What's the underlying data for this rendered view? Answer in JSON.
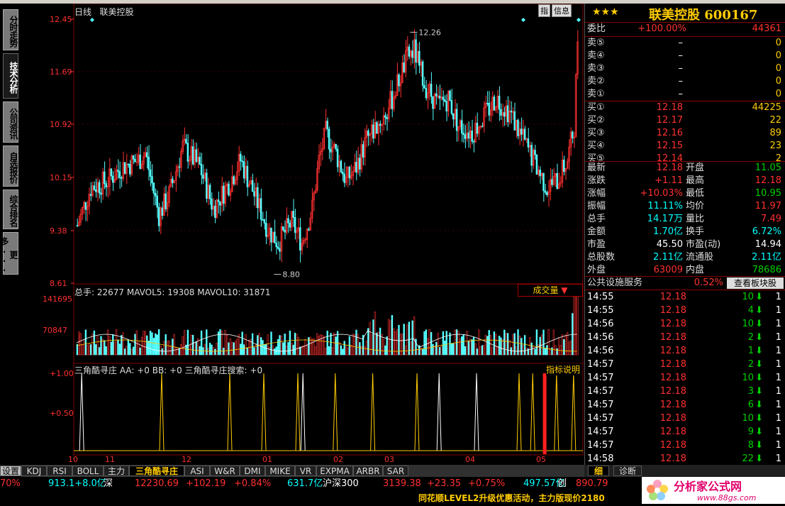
{
  "left_tabs": [
    "分时走势",
    "技术分析",
    "公司资讯",
    "自选报价",
    "综合排名",
    "更多..."
  ],
  "chart": {
    "period_label": "日线",
    "stock_label": "联美控股",
    "info_buttons": [
      "指",
      "信息"
    ],
    "price_axis": [
      "12.45",
      "11.69",
      "10.92",
      "10.15",
      "9.38",
      "8.61"
    ],
    "high_marker": "12.26",
    "low_marker": "8.80",
    "volume_title": "总手: 22677  MAVOL5: 19308  MAVOL10: 31871",
    "volume_axis": [
      "141695",
      "70847"
    ],
    "volume_dropdown": "成交量",
    "indicator_title": "三角酷寻庄 AA: +0  BB: +0  三角酷寻庄搜索: +0",
    "indicator_axis": [
      "+1.00",
      "+0.50"
    ],
    "indicator_explain": "指标说明",
    "month_axis": [
      "10",
      "11",
      "12",
      "01",
      "02",
      "03",
      "04",
      "05"
    ]
  },
  "bottom_tabs": [
    "设置",
    "KDJ",
    "RSI",
    "BOLL",
    "主力",
    "三角酷寻庄",
    "ASI",
    "W&R",
    "DMI",
    "MIKE",
    "VR",
    "EXPMA",
    "ARBR",
    "SAR"
  ],
  "quote": {
    "stars": "★★★",
    "title": "联美控股 600167",
    "weibi": {
      "label": "委比",
      "value": "+100.00%",
      "volume": "44361"
    },
    "sells": [
      {
        "label": "卖⑤",
        "price": "–",
        "vol": "0"
      },
      {
        "label": "卖④",
        "price": "–",
        "vol": "0"
      },
      {
        "label": "卖③",
        "price": "–",
        "vol": "0"
      },
      {
        "label": "卖②",
        "price": "–",
        "vol": "0"
      },
      {
        "label": "卖①",
        "price": "–",
        "vol": "0"
      }
    ],
    "buys": [
      {
        "label": "买①",
        "price": "12.18",
        "vol": "44225"
      },
      {
        "label": "买②",
        "price": "12.17",
        "vol": "22"
      },
      {
        "label": "买③",
        "price": "12.16",
        "vol": "89"
      },
      {
        "label": "买④",
        "price": "12.15",
        "vol": "23"
      },
      {
        "label": "买⑤",
        "price": "12.14",
        "vol": "2"
      }
    ],
    "stats": [
      {
        "l1": "最新",
        "v1": "12.18",
        "c1": "red",
        "l2": "开盘",
        "v2": "11.05",
        "c2": "grn"
      },
      {
        "l1": "涨跌",
        "v1": "+1.11",
        "c1": "red",
        "l2": "最高",
        "v2": "12.18",
        "c2": "red"
      },
      {
        "l1": "涨幅",
        "v1": "+10.03%",
        "c1": "red",
        "l2": "最低",
        "v2": "10.95",
        "c2": "grn"
      },
      {
        "l1": "振幅",
        "v1": "11.11%",
        "c1": "cyan",
        "l2": "均价",
        "v2": "11.97",
        "c2": "red"
      },
      {
        "l1": "总手",
        "v1": "14.17万",
        "c1": "cyan",
        "l2": "量比",
        "v2": "7.49",
        "c2": "red"
      },
      {
        "l1": "金额",
        "v1": "1.70亿",
        "c1": "cyan",
        "l2": "换手",
        "v2": "6.72%",
        "c2": "cyan"
      },
      {
        "l1": "市盈",
        "v1": "45.50",
        "c1": "wht",
        "l2": "市盈(动)",
        "v2": "14.94",
        "c2": "wht"
      },
      {
        "l1": "总股数",
        "v1": "2.11亿",
        "c1": "cyan",
        "l2": "流通股",
        "v2": "2.11亿",
        "c2": "cyan"
      },
      {
        "l1": "外盘",
        "v1": "63009",
        "c1": "red",
        "l2": "内盘",
        "v2": "78686",
        "c2": "grn"
      }
    ],
    "sector": {
      "name": "公共设施服务",
      "pct": "0.52%",
      "button": "查看板块股"
    },
    "ticks": [
      {
        "time": "14:55",
        "price": "12.18",
        "vol": "10",
        "n": "1"
      },
      {
        "time": "14:55",
        "price": "12.18",
        "vol": "4",
        "n": "1"
      },
      {
        "time": "14:56",
        "price": "12.18",
        "vol": "10",
        "n": "1"
      },
      {
        "time": "14:56",
        "price": "12.18",
        "vol": "2",
        "n": "1"
      },
      {
        "time": "14:56",
        "price": "12.18",
        "vol": "1",
        "n": "1"
      },
      {
        "time": "14:57",
        "price": "12.18",
        "vol": "2",
        "n": "1"
      },
      {
        "time": "14:57",
        "price": "12.18",
        "vol": "10",
        "n": "1"
      },
      {
        "time": "14:57",
        "price": "12.18",
        "vol": "3",
        "n": "1"
      },
      {
        "time": "14:57",
        "price": "12.18",
        "vol": "6",
        "n": "1"
      },
      {
        "time": "14:57",
        "price": "12.18",
        "vol": "10",
        "n": "1"
      },
      {
        "time": "14:57",
        "price": "12.18",
        "vol": "9",
        "n": "1"
      },
      {
        "time": "14:57",
        "price": "12.18",
        "vol": "8",
        "n": "1"
      },
      {
        "time": "14:58",
        "price": "12.18",
        "vol": "22",
        "n": "1"
      }
    ],
    "detail_tabs": [
      "细",
      "诊断"
    ]
  },
  "footer": {
    "items": [
      {
        "t": "70%",
        "c": "red"
      },
      {
        "t": "913.1+8.0亿",
        "c": "cyan"
      },
      {
        "t": "深",
        "c": "wht"
      },
      {
        "t": "12230.69",
        "c": "red"
      },
      {
        "t": "+102.19",
        "c": "red"
      },
      {
        "t": "+0.84%",
        "c": "red"
      },
      {
        "t": "631.7亿",
        "c": "cyan"
      },
      {
        "t": "沪深300",
        "c": "wht"
      },
      {
        "t": "3139.38",
        "c": "red"
      },
      {
        "t": "+23.35",
        "c": "red"
      },
      {
        "t": "+0.75%",
        "c": "red"
      },
      {
        "t": "497.57亿",
        "c": "cyan"
      },
      {
        "t": "创",
        "c": "wht"
      },
      {
        "t": "890.79",
        "c": "red"
      }
    ],
    "news": "同花顺LEVEL2升级优惠活动，主力版现价2180",
    "logo_text": "分析家公式网",
    "logo_url": "www.88gs.com"
  }
}
